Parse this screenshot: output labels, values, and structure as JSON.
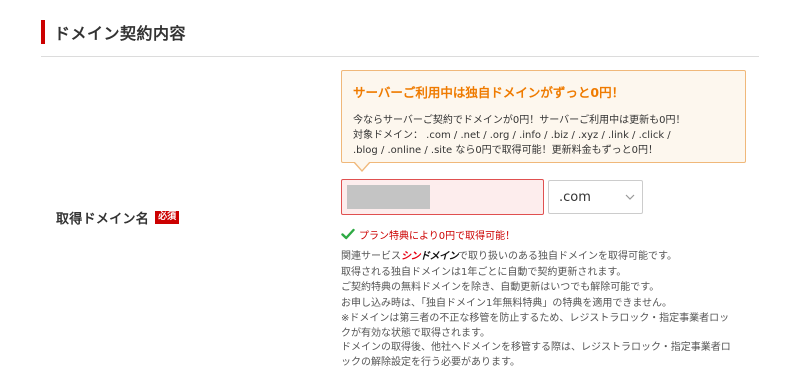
{
  "section": {
    "title": "ドメイン契約内容"
  },
  "field": {
    "label": "取得ドメイン名",
    "required_badge": "必須"
  },
  "promo": {
    "title": "サーバーご利用中は独自ドメインがずっと0円！",
    "line1": "今ならサーバーご契約でドメインが0円！サーバーご利用中は更新も0円！",
    "line2": "対象ドメイン： .com / .net / .org / .info / .biz / .xyz / .link / .click /",
    "line3": ".blog / .online / .site なら0円で取得可能！更新料金もずっと0円！"
  },
  "domain_input": {
    "value": ""
  },
  "tld_select": {
    "selected": ".com",
    "icon": "chevron-down-icon"
  },
  "status": {
    "icon": "check-icon",
    "text": "プラン特典により0円で取得可能！",
    "color": "#cc0000"
  },
  "description": {
    "line1_prefix": "関連サービス",
    "brand_part1": "シン",
    "brand_part2": "ドメイン",
    "line1_suffix": "で取り扱いのある独自ドメインを取得可能です。",
    "line2": "取得される独自ドメインは1年ごとに自動で契約更新されます。",
    "line3": "ご契約特典の無料ドメインを除き、自動更新はいつでも解除可能です。",
    "line4": "お申し込み時は、「独自ドメイン1年無料特典」の特典を適用できません。"
  },
  "notes": {
    "line1": "※ドメインは第三者の不正な移管を防止するため、レジストラロック・指定事業者ロッ",
    "line2": "クが有効な状態で取得されます。",
    "line3": "ドメインの取得後、他社へドメインを移管する際は、レジストラロック・指定事業者ロ",
    "line4": "ックの解除設定を行う必要があります。"
  },
  "colors": {
    "accent": "#cc0000",
    "promo_orange": "#ef7b00",
    "promo_bg": "#fdf7ee",
    "check_green": "#2eaa44"
  }
}
